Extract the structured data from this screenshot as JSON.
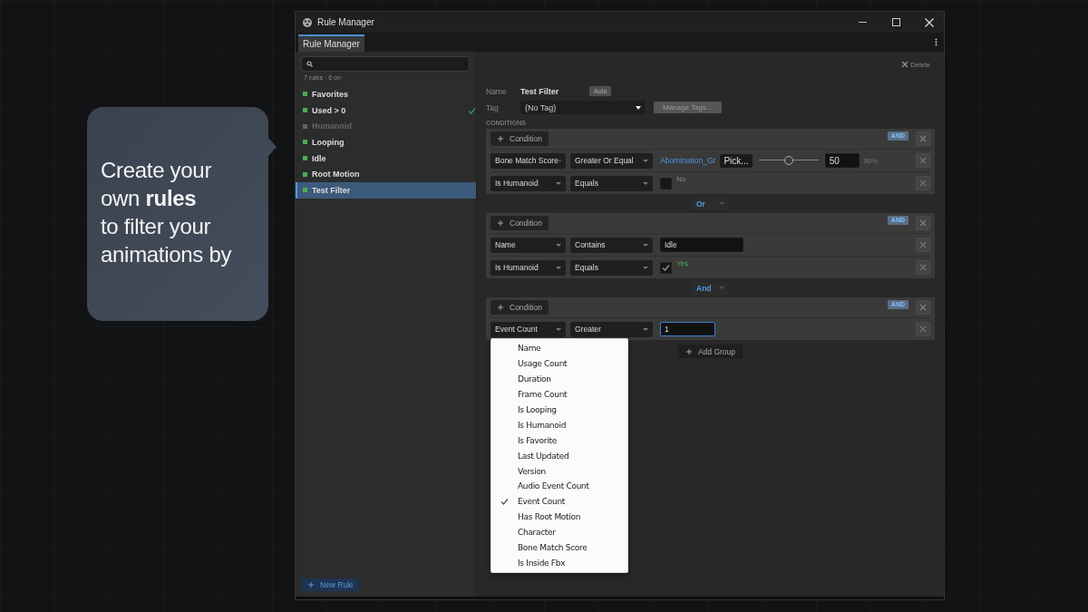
{
  "callout": {
    "lines": [
      "Create your",
      "own **rules**",
      "to filter your",
      "animations by"
    ]
  },
  "window": {
    "title": "Rule Manager"
  },
  "tabs": [
    {
      "label": "Rule Manager",
      "selected": true
    }
  ],
  "sidebar": {
    "summary": "7 rules · 6 on",
    "items": [
      {
        "label": "Favorites",
        "enabled": true,
        "checked": false,
        "selected": false
      },
      {
        "label": "Used > 0",
        "enabled": true,
        "checked": true,
        "selected": false
      },
      {
        "label": "Humanoid",
        "enabled": false,
        "checked": false,
        "selected": false
      },
      {
        "label": "Looping",
        "enabled": true,
        "checked": false,
        "selected": false
      },
      {
        "label": "Idle",
        "enabled": true,
        "checked": false,
        "selected": false
      },
      {
        "label": "Root Motion",
        "enabled": true,
        "checked": false,
        "selected": false
      },
      {
        "label": "Test Filter",
        "enabled": true,
        "checked": false,
        "selected": true
      }
    ],
    "new_rule_button": "New Rule"
  },
  "editor": {
    "delete_button": "Delete",
    "name_label": "Name",
    "name_value": "Test Filter",
    "auto_button": "Auto",
    "tag_label": "Tag",
    "tag_value": "(No Tag)",
    "manage_tags_button": "Manage Tags...",
    "conditions_heading": "CONDITIONS",
    "groups": [
      {
        "add_condition_button": "Condition",
        "mode": "AND",
        "conditions": [
          {
            "kind": "slider",
            "field": "Bone Match Score",
            "operator": "Greater Or Equal",
            "target": "Abomination_Gr",
            "pick_button": "Pick...",
            "level": 0.5,
            "value": "50",
            "reading": "50%"
          },
          {
            "kind": "bool",
            "field": "Is Humanoid",
            "operator": "Equals",
            "checked": false,
            "value_text": "No"
          }
        ]
      },
      {
        "joiner": "Or",
        "add_condition_button": "Condition",
        "mode": "AND",
        "conditions": [
          {
            "kind": "text",
            "field": "Name",
            "operator": "Contains",
            "value": "Idle",
            "focused": false
          },
          {
            "kind": "bool",
            "field": "Is Humanoid",
            "operator": "Equals",
            "checked": true,
            "value_text": "Yes"
          }
        ]
      },
      {
        "joiner": "And",
        "add_condition_button": "Condition",
        "mode": "AND",
        "conditions": [
          {
            "kind": "text",
            "field": "Event Count",
            "operator": "Greater",
            "value": "1",
            "focused": true
          }
        ]
      }
    ],
    "add_group_button": "Add Group"
  },
  "dropdown_menu": {
    "items": [
      {
        "label": "Name",
        "selected": false
      },
      {
        "label": "Usage Count",
        "selected": false
      },
      {
        "label": "Duration",
        "selected": false
      },
      {
        "label": "Frame Count",
        "selected": false
      },
      {
        "label": "Is Looping",
        "selected": false
      },
      {
        "label": "Is Humanoid",
        "selected": false
      },
      {
        "label": "Is Favorite",
        "selected": false
      },
      {
        "label": "Last Updated",
        "selected": false
      },
      {
        "label": "Version",
        "selected": false
      },
      {
        "label": "Audio Event Count",
        "selected": false
      },
      {
        "label": "Event Count",
        "selected": true
      },
      {
        "label": "Has Root Motion",
        "selected": false
      },
      {
        "label": "Character",
        "selected": false
      },
      {
        "label": "Bone Match Score",
        "selected": false
      },
      {
        "label": "Is Inside Fbx",
        "selected": false
      }
    ]
  }
}
